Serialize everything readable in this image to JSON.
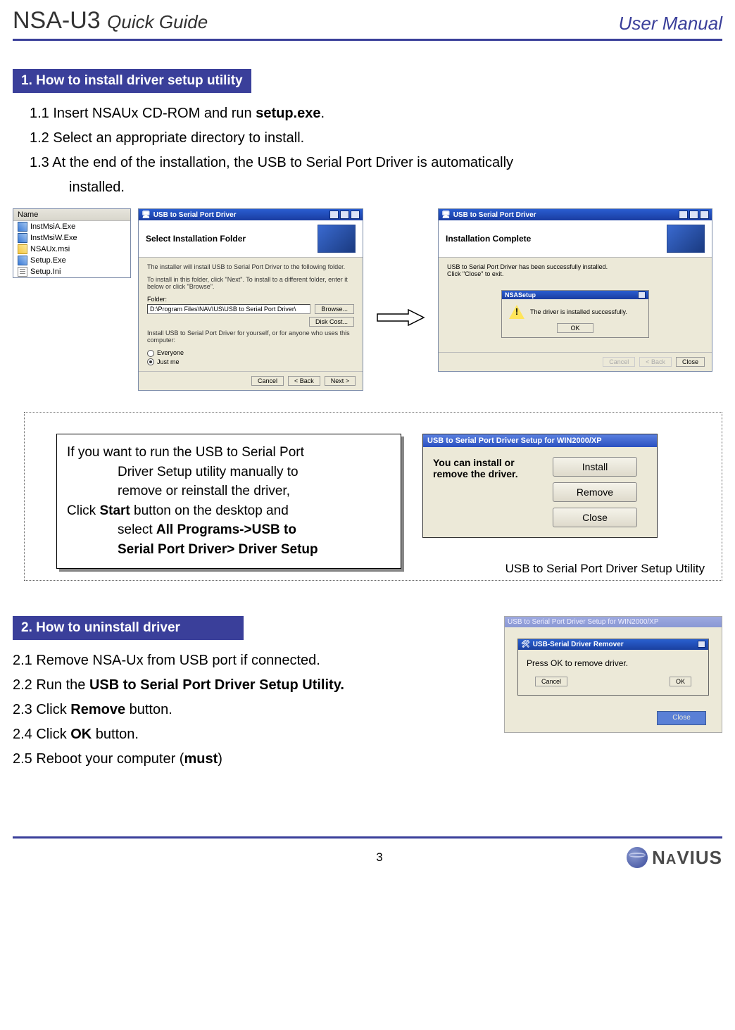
{
  "header": {
    "product": "NSA-U3",
    "subtitle": "Quick Guide",
    "right_label": "User Manual"
  },
  "section1": {
    "heading": "1. How to install driver setup utility",
    "step1_prefix": "1.1 Insert NSAUx CD-ROM and run ",
    "step1_bold": "setup.exe",
    "step1_suffix": ".",
    "step2": "1.2 Select an appropriate directory  to install.",
    "step3_line1": "1.3 At the end of the installation, the USB to Serial Port Driver is automatically",
    "step3_line2": "installed."
  },
  "explorer": {
    "col_header": "Name",
    "files": [
      "InstMsiA.Exe",
      "InstMsiW.Exe",
      "NSAUx.msi",
      "Setup.Exe",
      "Setup.Ini"
    ],
    "icons": [
      "ic-exe",
      "ic-exe",
      "ic-msi",
      "ic-exe",
      "ic-ini"
    ]
  },
  "installer1": {
    "titlebar": "USB to Serial Port Driver",
    "heading": "Select Installation Folder",
    "desc1": "The installer will install USB to Serial Port Driver to the following folder.",
    "desc2": "To install in this folder, click \"Next\". To install to a different folder, enter it below or click \"Browse\".",
    "folder_label": "Folder:",
    "folder_value": "D:\\Program Files\\NAVIUS\\USB to Serial Port Driver\\",
    "browse": "Browse...",
    "diskcost": "Disk Cost...",
    "share_q": "Install USB to Serial Port Driver for yourself, or for anyone who uses this computer:",
    "opt_everyone": "Everyone",
    "opt_justme": "Just me",
    "btn_cancel": "Cancel",
    "btn_back": "< Back",
    "btn_next": "Next >"
  },
  "installer2": {
    "titlebar": "USB to Serial Port Driver",
    "heading": "Installation Complete",
    "line1": "USB to Serial Port Driver has been successfully installed.",
    "line2": "Click \"Close\" to exit.",
    "alert_title": "NSASetup",
    "alert_msg": "The driver is installed successfully.",
    "alert_ok": "OK",
    "btn_cancel": "Cancel",
    "btn_back": "< Back",
    "btn_close": "Close"
  },
  "tip": {
    "line1": "If you want to run the USB to Serial Port",
    "line2": "Driver Setup utility manually to",
    "line3": "remove or reinstall the driver,",
    "line4a": "Click  ",
    "line4b": "Start",
    "line4c": " button on the desktop and",
    "line5a": "select ",
    "line5b": "All Programs->USB to",
    "line6a": "Serial Port Driver",
    "line6b": "> Driver Setup"
  },
  "driver_setup": {
    "titlebar": "USB to Serial Port Driver Setup for WIN2000/XP",
    "msg": "You can install or remove the driver.",
    "btn_install": "Install",
    "btn_remove": "Remove",
    "btn_close": "Close",
    "caption": "USB to Serial Port Driver Setup Utility"
  },
  "section2": {
    "heading": "2. How to uninstall driver",
    "s1": "2.1 Remove NSA-Ux from USB port if connected.",
    "s2a": "2.2 Run the ",
    "s2b": "USB to Serial Port Driver Setup Utility.",
    "s3a": "2.3 Click ",
    "s3b": "Remove",
    "s3c": " button.",
    "s4a": "2.4 Click ",
    "s4b": "OK",
    "s4c": " button.",
    "s5a": "2.5 Reboot your computer (",
    "s5b": "must",
    "s5c": ")"
  },
  "remover": {
    "outer_title": "USB to Serial Port Driver Setup for WIN2000/XP",
    "inner_title": "USB-Serial Driver Remover",
    "msg": "Press OK to remove driver.",
    "btn_cancel": "Cancel",
    "btn_ok": "OK",
    "ghost_btn": "Close"
  },
  "footer": {
    "page": "3",
    "logo_text": "NAVIUS"
  }
}
